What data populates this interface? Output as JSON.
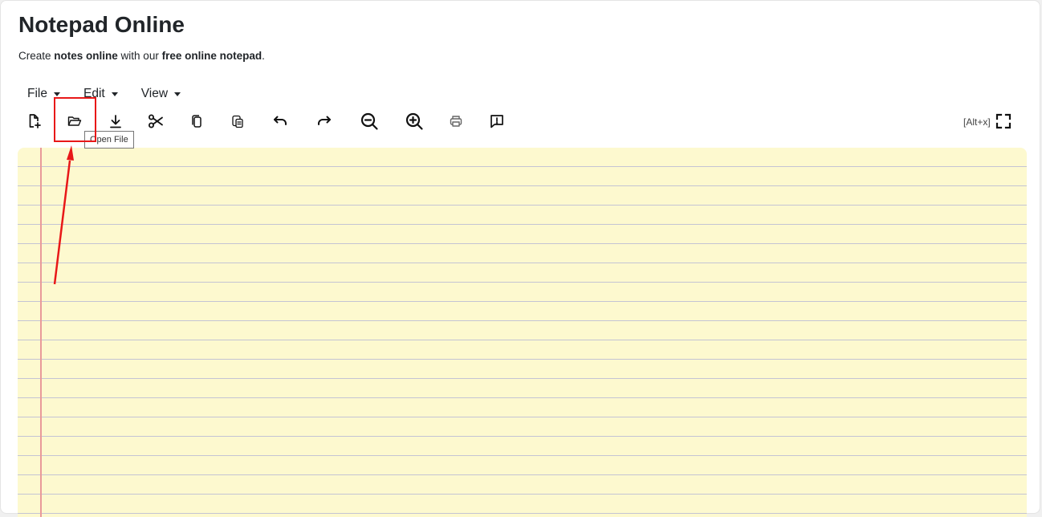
{
  "app": {
    "title": "Notepad Online",
    "subtitle": {
      "part1": "Create ",
      "bold1": "notes online",
      "part2": " with our ",
      "bold2": "free online notepad",
      "part3": "."
    }
  },
  "menu": {
    "file": "File",
    "edit": "Edit",
    "view": "View"
  },
  "toolbar": {
    "items": [
      {
        "name": "new-file",
        "icon": "file-plus-icon"
      },
      {
        "name": "open-file",
        "icon": "folder-open-icon"
      },
      {
        "name": "save",
        "icon": "download-icon"
      },
      {
        "name": "cut",
        "icon": "scissors-icon"
      },
      {
        "name": "copy",
        "icon": "copy-icon"
      },
      {
        "name": "paste",
        "icon": "paste-icon"
      },
      {
        "name": "undo",
        "icon": "undo-icon"
      },
      {
        "name": "redo",
        "icon": "redo-icon"
      },
      {
        "name": "zoom-out",
        "icon": "zoom-out-icon"
      },
      {
        "name": "zoom-in",
        "icon": "zoom-in-icon"
      },
      {
        "name": "print",
        "icon": "printer-icon"
      },
      {
        "name": "feedback",
        "icon": "alert-message-icon"
      }
    ],
    "tooltip": "Open File",
    "fullscreen_hint": "[Alt+x]",
    "fullscreen_icon": "fullscreen-icon"
  },
  "editor": {
    "value": "",
    "paper_color": "#fdf9cf",
    "rule_color": "#c4c4d4",
    "margin_color": "#e99a9a"
  },
  "annotation": {
    "highlight_color": "#e81818"
  }
}
